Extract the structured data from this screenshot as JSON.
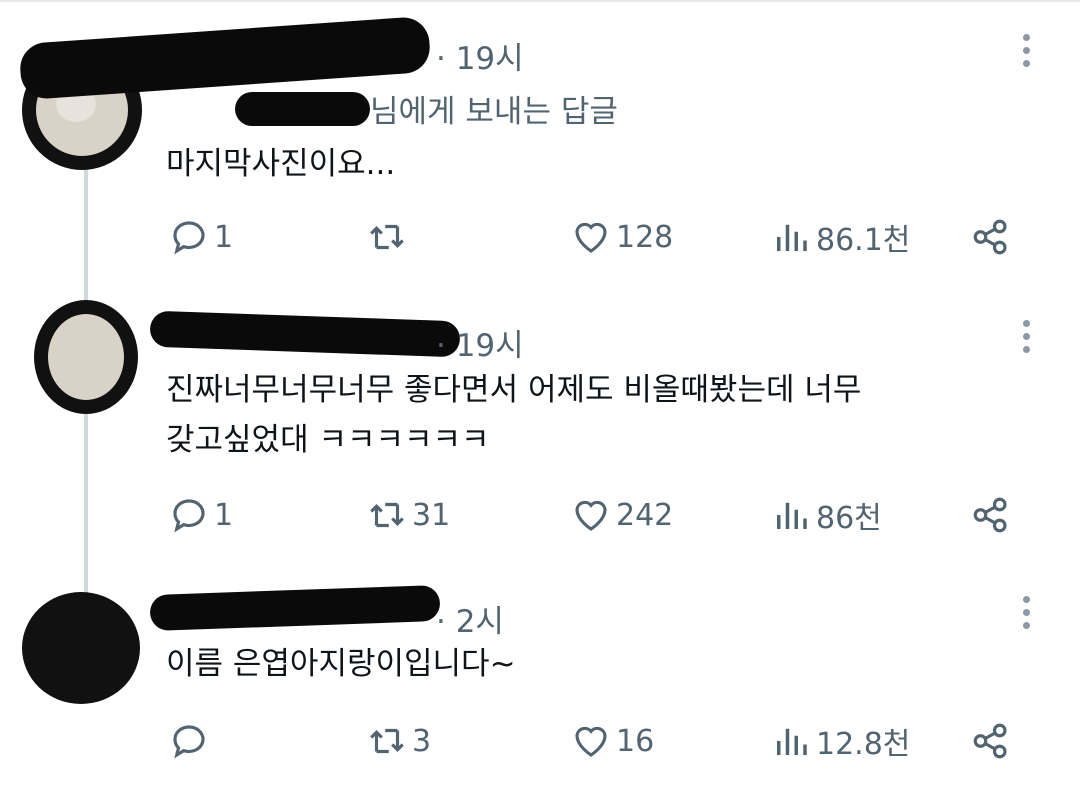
{
  "tweets": [
    {
      "time": "· 19시",
      "reply_to": "님에게 보내는 답글",
      "lines": [
        "마지막사진이요..."
      ],
      "replies": "1",
      "retweets": "",
      "likes": "128",
      "views": "86.1천"
    },
    {
      "time": "· 19시",
      "reply_to": "",
      "lines": [
        "진짜너무너무너무 좋다면서 어제도 비올때봤는데 너무",
        "갖고싶었대 ㅋㅋㅋㅋㅋㅋ"
      ],
      "replies": "1",
      "retweets": "31",
      "likes": "242",
      "views": "86천"
    },
    {
      "time": "· 2시",
      "reply_to": "",
      "lines": [
        "이름 은엽아지랑이입니다~"
      ],
      "replies": "",
      "retweets": "3",
      "likes": "16",
      "views": "12.8천"
    }
  ],
  "icons": {
    "reply": "reply-icon",
    "retweet": "retweet-icon",
    "like": "heart-icon",
    "views": "views-icon",
    "share": "share-icon",
    "more": "more-icon"
  },
  "colors": {
    "text": "#0f1419",
    "muted": "#536471",
    "thread_line": "#cfd9de",
    "redaction": "#0a0a0a"
  }
}
